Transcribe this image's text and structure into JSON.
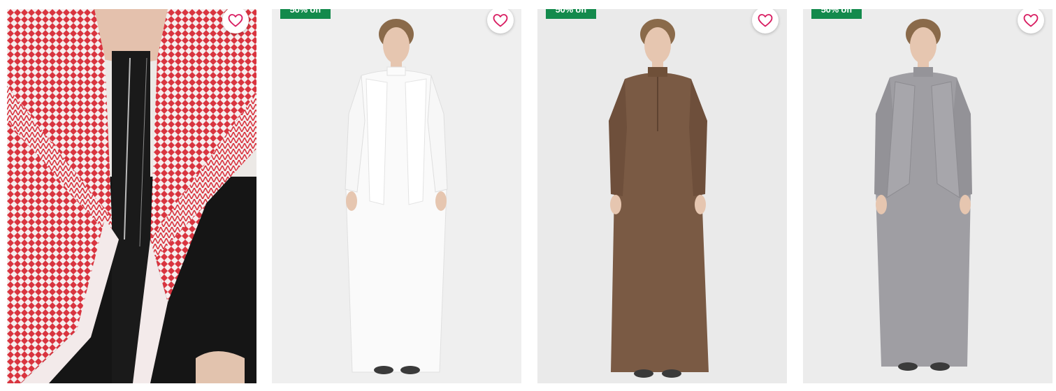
{
  "products": [
    {
      "image": "man-in-red-white-shemagh-and-black-thobe",
      "discount_badge": ""
    },
    {
      "image": "man-in-white-thobe-with-vest",
      "discount_badge": "50% off"
    },
    {
      "image": "man-in-brown-thobe",
      "discount_badge": "50% off"
    },
    {
      "image": "man-in-grey-thobe-with-vest",
      "discount_badge": "50% off"
    }
  ],
  "icons": {
    "favorite": "heart-outline-icon"
  },
  "colors": {
    "badge": "#138a4c",
    "heart": "#d81b60"
  }
}
